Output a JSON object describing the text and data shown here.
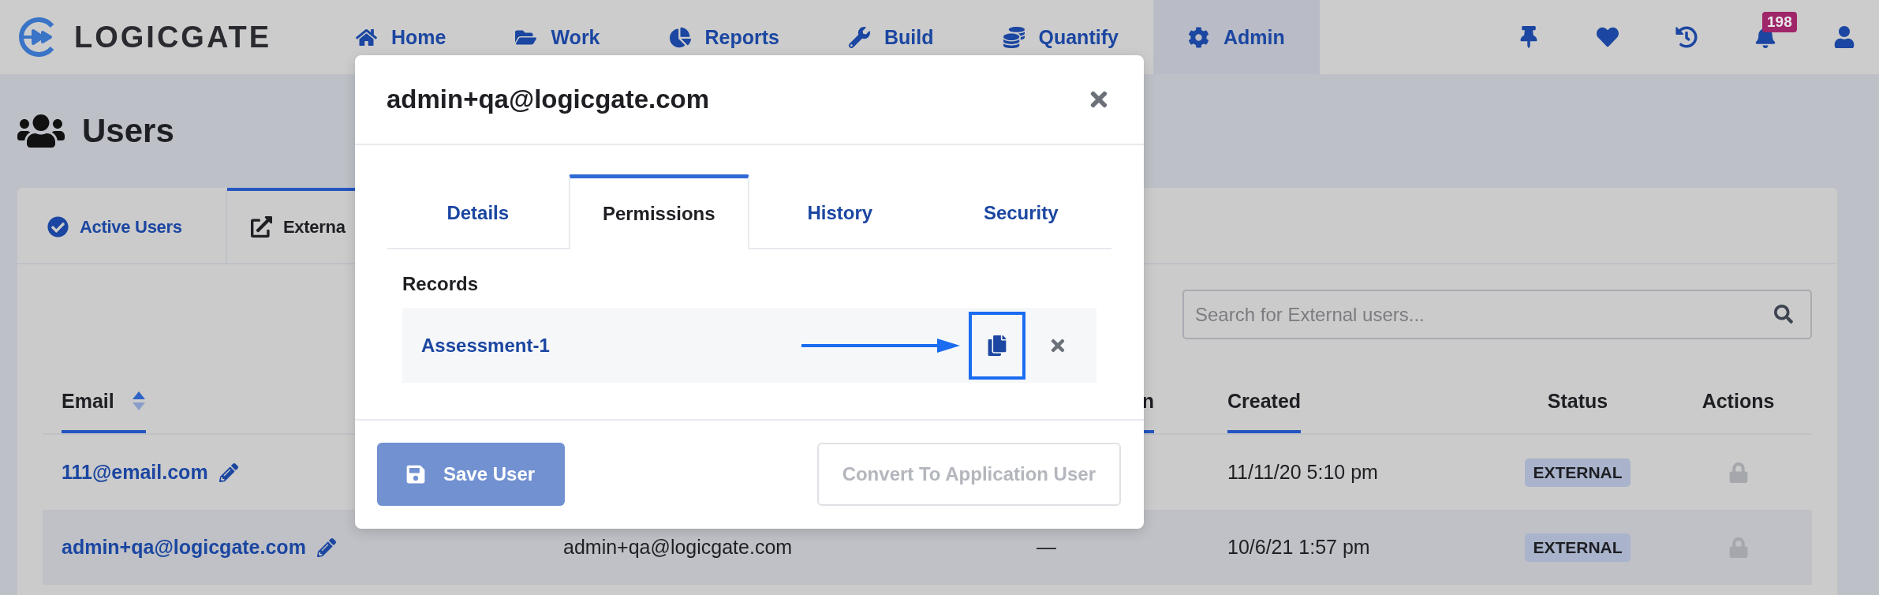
{
  "nav": {
    "logo": "LOGICGATE",
    "items": [
      {
        "label": "Home",
        "selected": false
      },
      {
        "label": "Work",
        "selected": false
      },
      {
        "label": "Reports",
        "selected": false
      },
      {
        "label": "Build",
        "selected": false
      },
      {
        "label": "Quantify",
        "selected": false
      },
      {
        "label": "Admin",
        "selected": true
      }
    ],
    "notifications": "198"
  },
  "page": {
    "title": "Users"
  },
  "tabs": [
    {
      "label": "Active Users",
      "selected": false
    },
    {
      "label": "Externa",
      "selected": true
    }
  ],
  "search": {
    "placeholder": "Search for External users..."
  },
  "table": {
    "columns": {
      "email": {
        "label": "Email",
        "sortable": true,
        "sorted": true
      },
      "column_3": {
        "label": "n",
        "sortable": true,
        "sorted": false
      },
      "created": {
        "label": "Created",
        "sortable": true,
        "sorted": false
      },
      "status": {
        "label": "Status",
        "sortable": false,
        "sorted": false
      },
      "actions": {
        "label": "Actions",
        "sortable": false,
        "sorted": false
      }
    },
    "rows": [
      {
        "email": "111@email.com",
        "created": "11/11/20 5:10 pm",
        "status": "EXTERNAL",
        "highlighted": false
      },
      {
        "email": "admin+qa@logicgate.com",
        "column_2": "admin+qa@logicgate.com",
        "column_3": "—",
        "created": "10/6/21 1:57 pm",
        "status": "EXTERNAL",
        "highlighted": true
      }
    ]
  },
  "modal": {
    "title": "admin+qa@logicgate.com",
    "tabs": [
      {
        "label": "Details",
        "selected": false
      },
      {
        "label": "Permissions",
        "selected": true
      },
      {
        "label": "History",
        "selected": false
      },
      {
        "label": "Security",
        "selected": false
      }
    ],
    "section_label": "Records",
    "records": [
      {
        "name": "Assessment-1",
        "copy_highlighted": true
      }
    ],
    "buttons": [
      {
        "kind": "primary",
        "label": "Save User",
        "disabled": true
      },
      {
        "kind": "secondary",
        "label": "Convert To Application User",
        "disabled": true
      }
    ]
  }
}
